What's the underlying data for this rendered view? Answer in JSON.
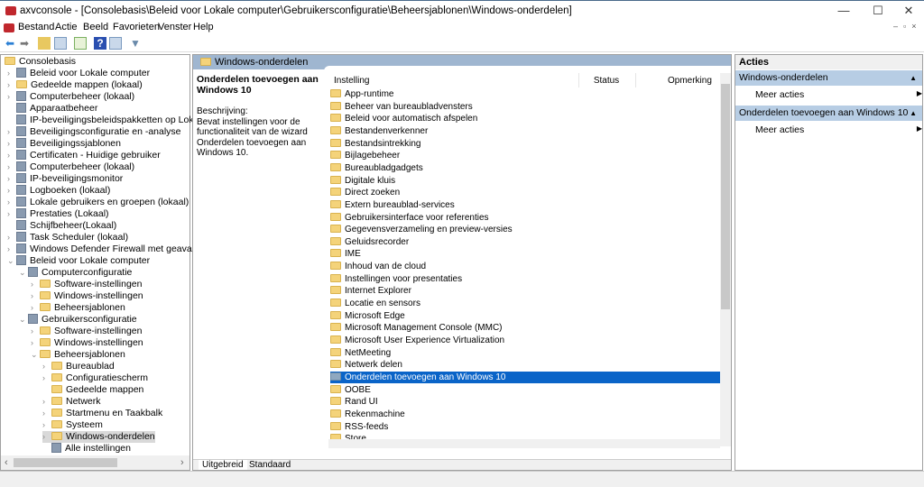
{
  "window": {
    "title": "axvconsole - [Consolebasis\\Beleid voor Lokale computer\\Gebruikersconfiguratie\\Beheersjablonen\\Windows-onderdelen]",
    "minimize": "—",
    "maximize": "☐",
    "close": "✕"
  },
  "menu": [
    "Bestand",
    "Actie",
    "Beeld",
    "Favorieten",
    "Venster",
    "Help"
  ],
  "tree": [
    {
      "label": "Consolebasis",
      "level": 0,
      "exp": "",
      "icon": "folder"
    },
    {
      "label": "Beleid voor Lokale computer",
      "level": 1,
      "exp": ">",
      "icon": "policy"
    },
    {
      "label": "Gedeelde mappen (lokaal)",
      "level": 1,
      "exp": ">",
      "icon": "folder"
    },
    {
      "label": "Computerbeheer (lokaal)",
      "level": 1,
      "exp": ">",
      "icon": "computer"
    },
    {
      "label": "Apparaatbeheer",
      "level": 1,
      "exp": "",
      "icon": "device"
    },
    {
      "label": "IP-beveiligingsbeleidspakketten op Lokale com",
      "level": 1,
      "exp": "",
      "icon": "shield"
    },
    {
      "label": "Beveiligingsconfiguratie en -analyse",
      "level": 1,
      "exp": ">",
      "icon": "shield"
    },
    {
      "label": "Beveiligingssjablonen",
      "level": 1,
      "exp": ">",
      "icon": "shield"
    },
    {
      "label": "Certificaten - Huidige gebruiker",
      "level": 1,
      "exp": ">",
      "icon": "cert"
    },
    {
      "label": "Computerbeheer (lokaal)",
      "level": 1,
      "exp": ">",
      "icon": "computer"
    },
    {
      "label": "IP-beveiligingsmonitor",
      "level": 1,
      "exp": ">",
      "icon": "monitor"
    },
    {
      "label": "Logboeken (lokaal)",
      "level": 1,
      "exp": ">",
      "icon": "log"
    },
    {
      "label": "Lokale gebruikers en groepen (lokaal)",
      "level": 1,
      "exp": ">",
      "icon": "users"
    },
    {
      "label": "Prestaties (Lokaal)",
      "level": 1,
      "exp": ">",
      "icon": "perf"
    },
    {
      "label": "Schijfbeheer(Lokaal)",
      "level": 1,
      "exp": "",
      "icon": "disk"
    },
    {
      "label": "Task Scheduler (lokaal)",
      "level": 1,
      "exp": ">",
      "icon": "clock"
    },
    {
      "label": "Windows Defender Firewall met geavanceerde",
      "level": 1,
      "exp": ">",
      "icon": "firewall"
    },
    {
      "label": "Beleid voor Lokale computer",
      "level": 1,
      "exp": "v",
      "icon": "policy"
    },
    {
      "label": "Computerconfiguratie",
      "level": 2,
      "exp": "v",
      "icon": "computer"
    },
    {
      "label": "Software-instellingen",
      "level": 3,
      "exp": ">",
      "icon": "folder"
    },
    {
      "label": "Windows-instellingen",
      "level": 3,
      "exp": ">",
      "icon": "folder"
    },
    {
      "label": "Beheersjablonen",
      "level": 3,
      "exp": ">",
      "icon": "folder"
    },
    {
      "label": "Gebruikersconfiguratie",
      "level": 2,
      "exp": "v",
      "icon": "users"
    },
    {
      "label": "Software-instellingen",
      "level": 3,
      "exp": ">",
      "icon": "folder"
    },
    {
      "label": "Windows-instellingen",
      "level": 3,
      "exp": ">",
      "icon": "folder"
    },
    {
      "label": "Beheersjablonen",
      "level": 3,
      "exp": "v",
      "icon": "folder"
    },
    {
      "label": "Bureaublad",
      "level": 4,
      "exp": ">",
      "icon": "folder"
    },
    {
      "label": "Configuratiescherm",
      "level": 4,
      "exp": ">",
      "icon": "folder"
    },
    {
      "label": "Gedeelde mappen",
      "level": 4,
      "exp": "",
      "icon": "folder"
    },
    {
      "label": "Netwerk",
      "level": 4,
      "exp": ">",
      "icon": "folder"
    },
    {
      "label": "Startmenu en Taakbalk",
      "level": 4,
      "exp": ">",
      "icon": "folder"
    },
    {
      "label": "Systeem",
      "level": 4,
      "exp": ">",
      "icon": "folder"
    },
    {
      "label": "Windows-onderdelen",
      "level": 4,
      "exp": ">",
      "icon": "folder",
      "selected": true
    },
    {
      "label": "Alle instellingen",
      "level": 4,
      "exp": "",
      "icon": "settings"
    }
  ],
  "middle": {
    "header": "Windows-onderdelen",
    "desc_title": "Onderdelen toevoegen aan Windows 10",
    "desc_label": "Beschrijving:",
    "desc_text": "Bevat instellingen voor de functionaliteit van de wizard Onderdelen toevoegen aan Windows 10.",
    "columns": [
      "Instelling",
      "Status",
      "Opmerking"
    ],
    "items": [
      "App-runtime",
      "Beheer van bureaubladvensters",
      "Beleid voor automatisch afspelen",
      "Bestandenverkenner",
      "Bestandsintrekking",
      "Bijlagebeheer",
      "Bureaubladgadgets",
      "Digitale kluis",
      "Direct zoeken",
      "Extern bureaublad-services",
      "Gebruikersinterface voor referenties",
      "Gegevensverzameling en preview-versies",
      "Geluidsrecorder",
      "IME",
      "Inhoud van de cloud",
      "Instellingen voor presentaties",
      "Internet Explorer",
      "Locatie en sensors",
      "Microsoft Edge",
      "Microsoft Management Console (MMC)",
      "Microsoft User Experience Virtualization",
      "NetMeeting",
      "Netwerk delen",
      "Onderdelen toevoegen aan Windows 10",
      "OOBE",
      "Rand UI",
      "Rekenmachine",
      "RSS-feeds",
      "Store"
    ],
    "selected_index": 23,
    "tabs": [
      "Uitgebreid",
      "Standaard"
    ]
  },
  "actions": {
    "title": "Acties",
    "groups": [
      {
        "header": "Windows-onderdelen",
        "item": "Meer acties"
      },
      {
        "header": "Onderdelen toevoegen aan Windows 10",
        "item": "Meer acties"
      }
    ]
  }
}
